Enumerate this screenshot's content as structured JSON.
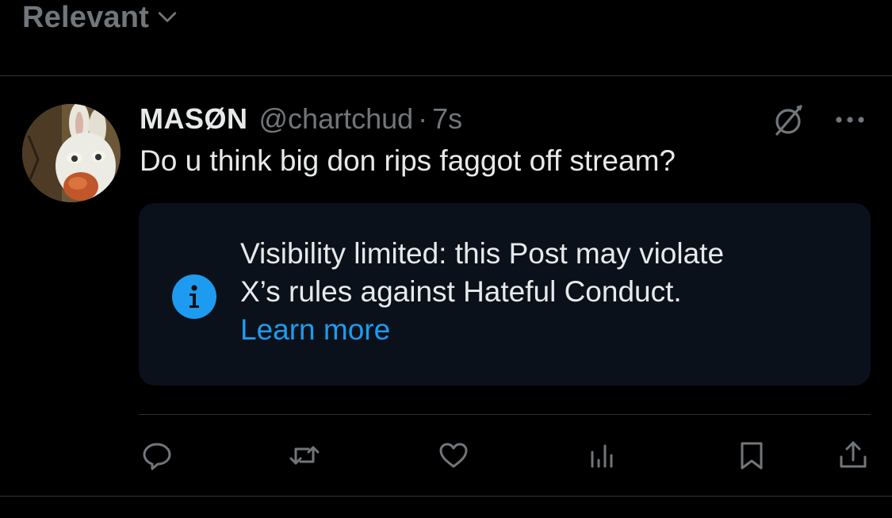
{
  "sort": {
    "label": "Relevant",
    "icon": "chevron-down-icon"
  },
  "tweet": {
    "display_name": "MASØN",
    "handle": "@chartchud",
    "separator": "·",
    "time": "7s",
    "text": "Do u think big don rips faggot off stream?",
    "avatar": "avatar-image",
    "limited_icon": "limited-visibility-icon",
    "more_icon": "more-options-icon"
  },
  "notice": {
    "line1": "Visibility limited: this Post may violate",
    "line2": "X’s rules against Hateful Conduct.",
    "link": "Learn more",
    "icon": "info-icon"
  },
  "actions": [
    {
      "name": "reply",
      "icon": "reply-icon"
    },
    {
      "name": "repost",
      "icon": "repost-icon"
    },
    {
      "name": "like",
      "icon": "heart-icon"
    },
    {
      "name": "views",
      "icon": "analytics-icon"
    },
    {
      "name": "bookmark",
      "icon": "bookmark-icon"
    },
    {
      "name": "share",
      "icon": "share-icon"
    }
  ],
  "colors": {
    "background": "#000000",
    "text_primary": "#e7e9ea",
    "text_secondary": "#71767b",
    "accent": "#1d9bf0",
    "divider": "#2f3336",
    "notice_bg": "#0b111a"
  }
}
